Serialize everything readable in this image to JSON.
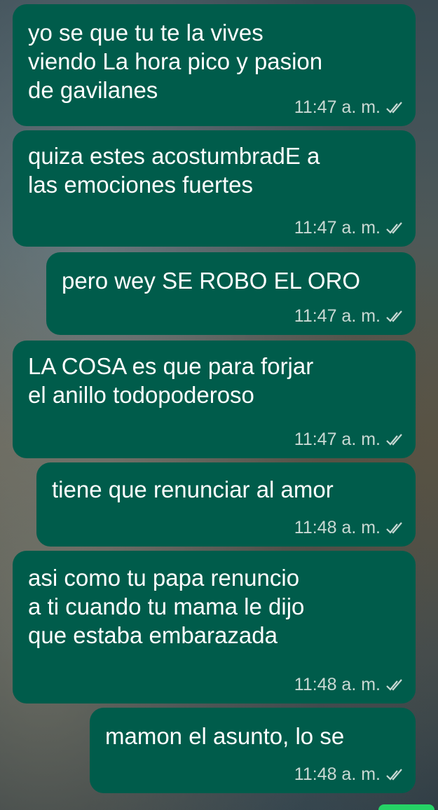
{
  "colors": {
    "bubble": "#005c4b",
    "text": "#ffffff",
    "meta": "#c9d9d4"
  },
  "messages": [
    {
      "text": "yo se que tu te la vives\nviendo La hora pico y pasion\nde gavilanes",
      "time": "11:47 a. m."
    },
    {
      "text": "quiza estes acostumbradE a\nlas emociones fuertes",
      "time": "11:47 a. m."
    },
    {
      "text": "pero wey SE ROBO EL ORO",
      "time": "11:47 a. m."
    },
    {
      "text": "LA COSA es que para forjar\nel anillo todopoderoso",
      "time": "11:47 a. m."
    },
    {
      "text": "tiene que renunciar al amor",
      "time": "11:48 a. m."
    },
    {
      "text": "asi como tu papa renuncio\na ti cuando tu mama le dijo\nque estaba embarazada",
      "time": "11:48 a. m."
    },
    {
      "text": "mamon el asunto, lo se",
      "time": "11:48 a. m."
    }
  ],
  "icons": {
    "read_receipt": "double-check-icon"
  }
}
